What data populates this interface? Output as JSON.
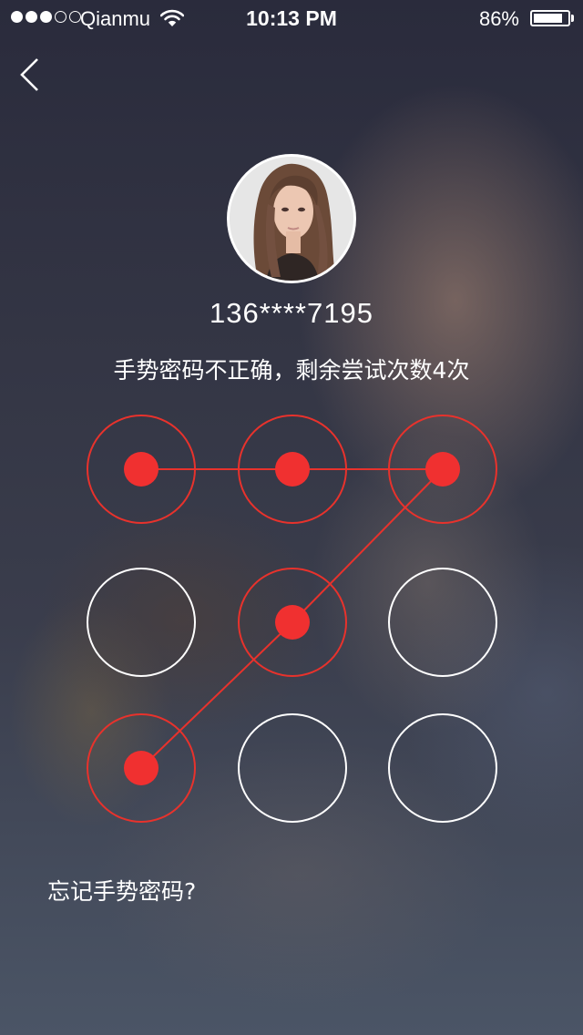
{
  "status_bar": {
    "signal_strength": 3,
    "signal_max": 5,
    "carrier": "Qianmu",
    "wifi_icon": "wifi-icon",
    "time": "10:13 PM",
    "battery_percent": "86%",
    "battery_level": 0.86
  },
  "nav": {
    "back_icon": "chevron-left-icon"
  },
  "profile": {
    "avatar_icon": "user-avatar-photo",
    "phone": "136****7195"
  },
  "lock": {
    "message": "手势密码不正确，剩余尝试次数4次",
    "error_color": "#e8322c",
    "grid": [
      {
        "row": 1,
        "col": 1,
        "selected": true
      },
      {
        "row": 1,
        "col": 2,
        "selected": true
      },
      {
        "row": 1,
        "col": 3,
        "selected": true
      },
      {
        "row": 2,
        "col": 1,
        "selected": false
      },
      {
        "row": 2,
        "col": 2,
        "selected": true
      },
      {
        "row": 2,
        "col": 3,
        "selected": false
      },
      {
        "row": 3,
        "col": 1,
        "selected": true
      },
      {
        "row": 3,
        "col": 2,
        "selected": false
      },
      {
        "row": 3,
        "col": 3,
        "selected": false
      }
    ],
    "pattern_sequence": [
      1,
      2,
      3,
      5,
      7
    ]
  },
  "footer": {
    "forgot_label": "忘记手势密码?"
  }
}
